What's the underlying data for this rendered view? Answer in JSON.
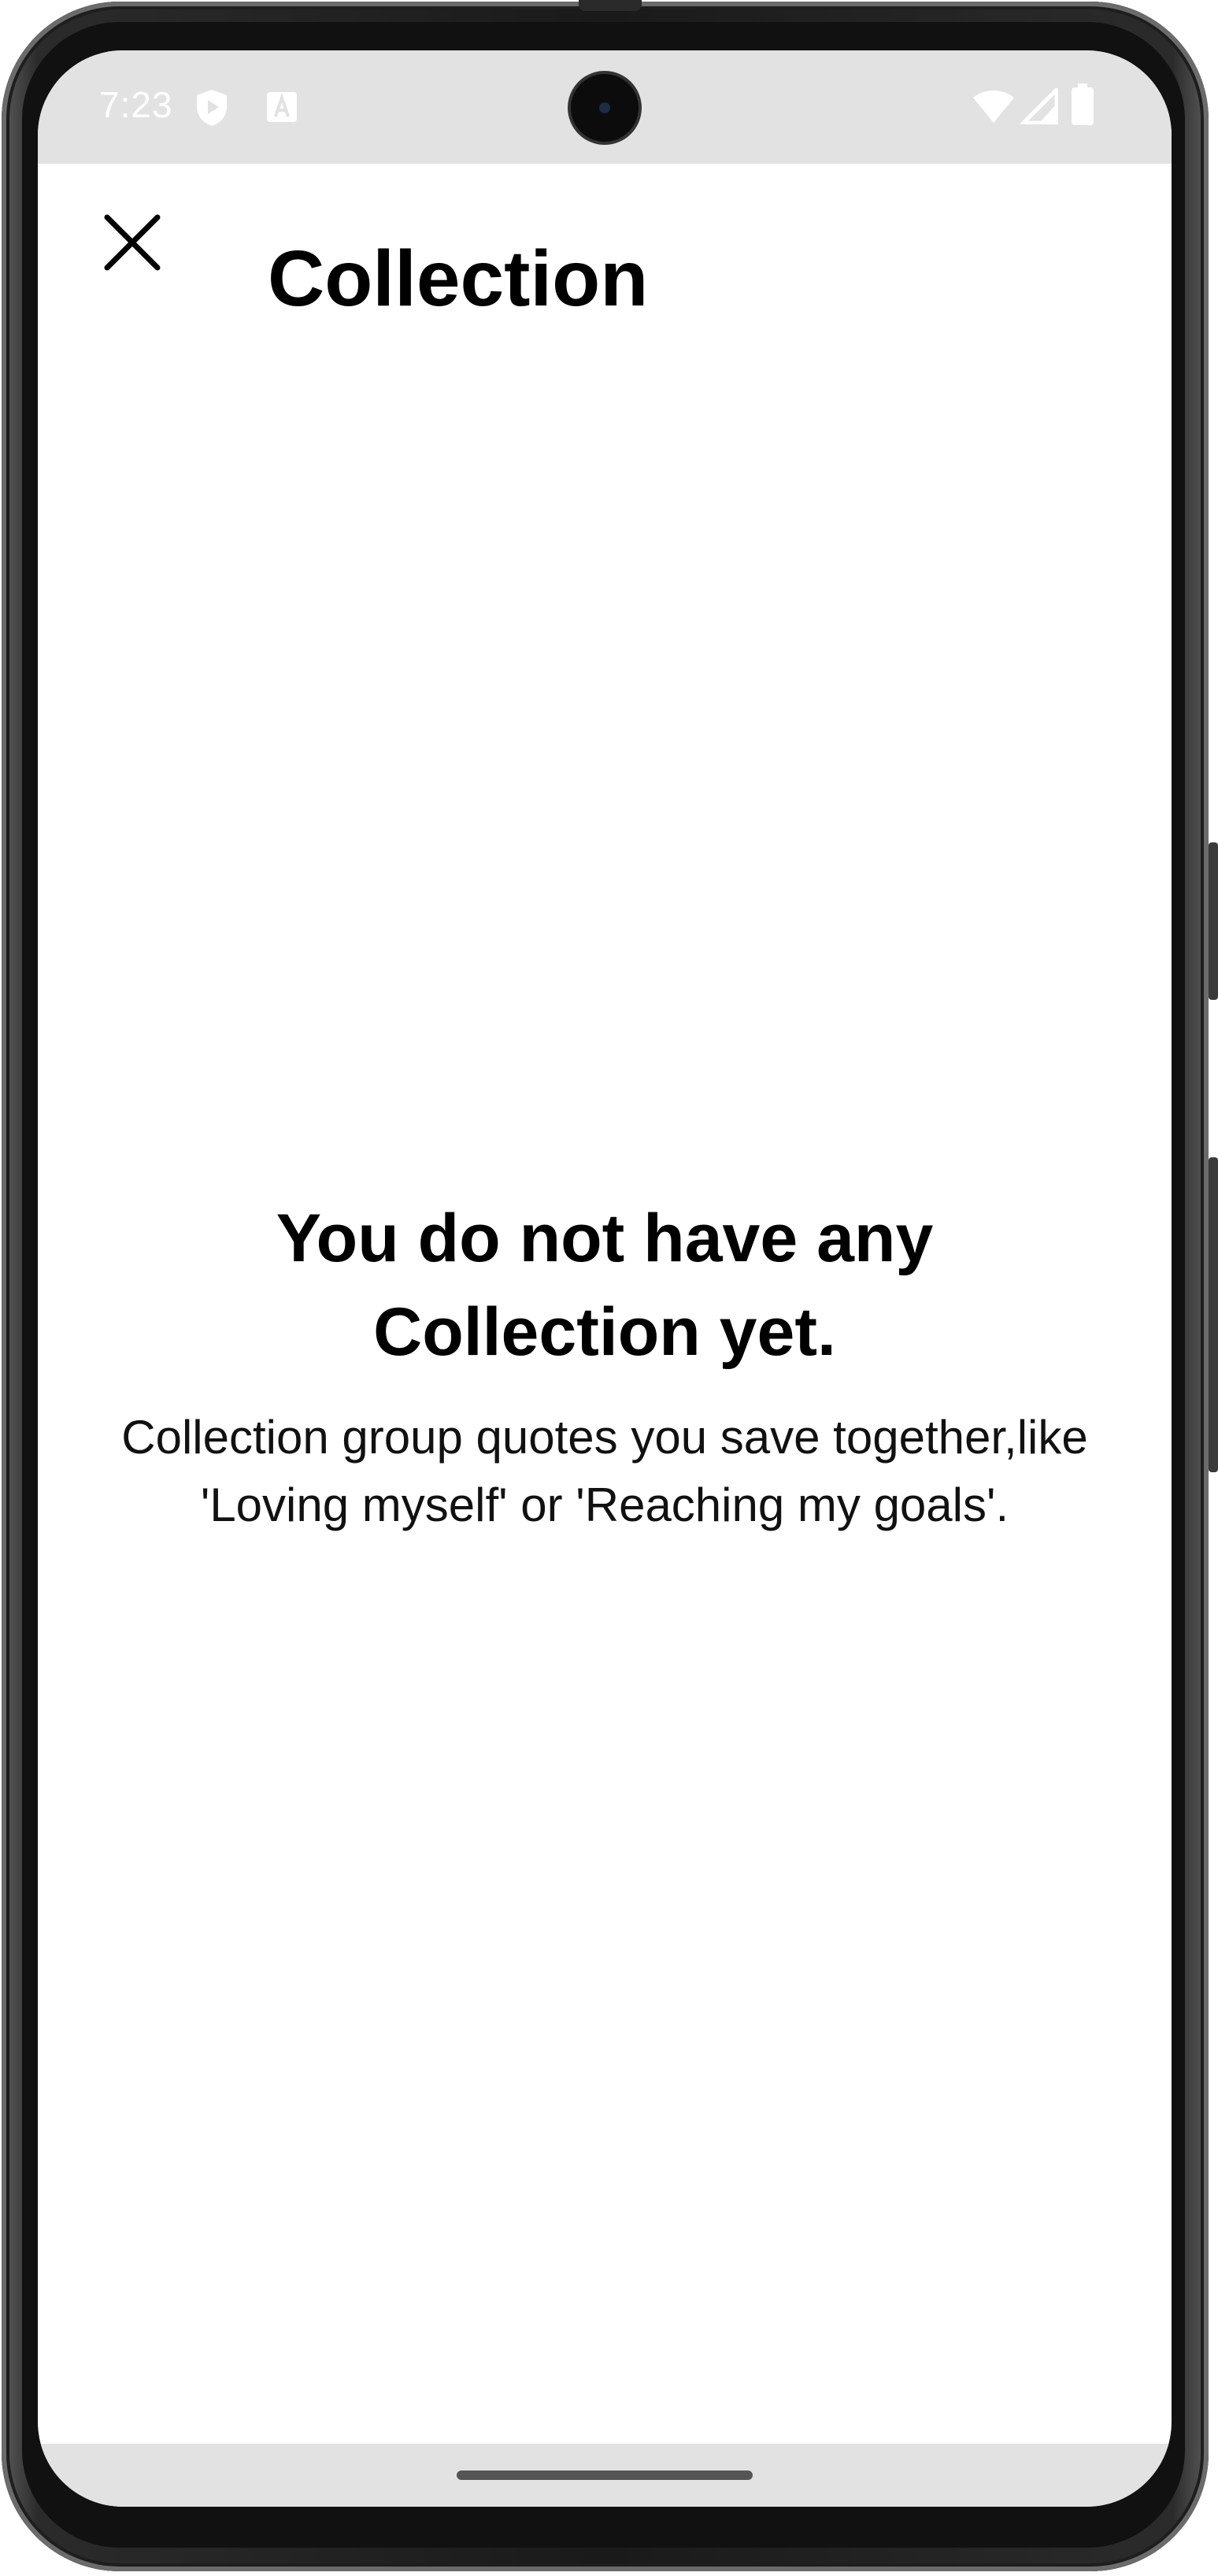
{
  "status_bar": {
    "time": "7:23",
    "left_icons": [
      "shield-play-icon",
      "text-a-icon"
    ],
    "right_icons": [
      "wifi-icon",
      "cell-signal-icon",
      "battery-icon"
    ]
  },
  "header": {
    "title": "Collection",
    "close_icon": "close-icon"
  },
  "empty_state": {
    "heading": "You do not have any Collection yet.",
    "description": "Collection group quotes you save together,like 'Loving myself' or 'Reaching my goals'."
  },
  "colors": {
    "status_bar_bg": "#e2e2e2",
    "background": "#ffffff",
    "text": "#000000"
  }
}
